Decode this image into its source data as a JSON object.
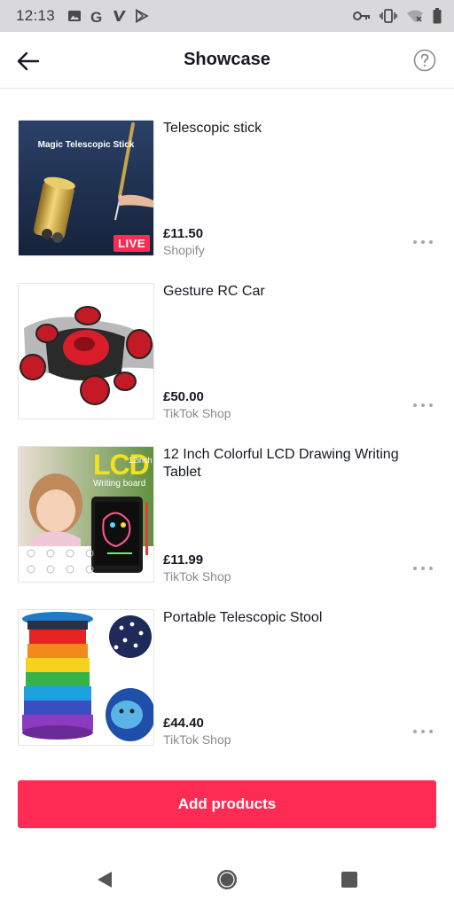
{
  "status_bar": {
    "time": "12:13",
    "left_icons": [
      "image-icon",
      "google-icon",
      "v-icon",
      "play-store-icon"
    ],
    "right_icons": [
      "key-icon",
      "vibrate-icon",
      "wifi-off-icon",
      "battery-icon"
    ]
  },
  "header": {
    "title": "Showcase",
    "back_icon": "back-arrow-icon",
    "help_icon": "help-circle-icon"
  },
  "products": [
    {
      "title": "Telescopic stick",
      "price": "£11.50",
      "source": "Shopify",
      "thumb_caption": "Magic Telescopic Stick",
      "badge": "LIVE"
    },
    {
      "title": "Gesture RC Car",
      "price": "£50.00",
      "source": "TikTok Shop"
    },
    {
      "title": "12 Inch Colorful LCD Drawing Writing Tablet",
      "price": "£11.99",
      "source": "TikTok Shop",
      "thumb_logo": "LCD",
      "thumb_sub": "Writing board",
      "thumb_size": "12inch"
    },
    {
      "title": "Portable Telescopic Stool",
      "price": "£44.40",
      "source": "TikTok Shop"
    }
  ],
  "add_button_label": "Add products",
  "colors": {
    "accent": "#fe2c55",
    "text_primary": "#161823",
    "text_secondary": "#8a8b91",
    "status_bar_bg": "#d9d9db"
  },
  "nav_bar": [
    "back-triangle-icon",
    "home-circle-icon",
    "recents-square-icon"
  ]
}
